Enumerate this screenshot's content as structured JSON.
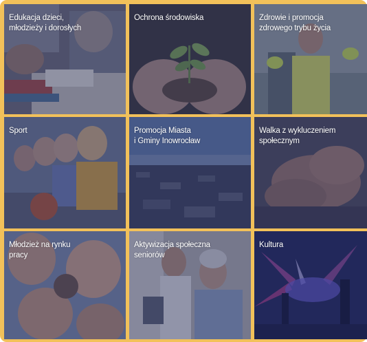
{
  "tiles": [
    {
      "label": "Edukacja dzieci,\nmłodzieży i dorosłych",
      "icon": "education-image"
    },
    {
      "label": "Ochrona środowiska",
      "icon": "environment-image"
    },
    {
      "label": "Zdrowie i promocja\nzdrowego trybu życia",
      "icon": "health-image"
    },
    {
      "label": "Sport",
      "icon": "sport-image"
    },
    {
      "label": "Promocja Miasta\ni Gminy Inowrocław",
      "icon": "city-image"
    },
    {
      "label": "Walka z wykluczeniem\nspołecznym",
      "icon": "social-inclusion-image"
    },
    {
      "label": "Młodzież na rynku\npracy",
      "icon": "youth-work-image"
    },
    {
      "label": "Aktywizacja społeczna\nseniorów",
      "icon": "seniors-image"
    },
    {
      "label": "Kultura",
      "icon": "culture-image"
    }
  ],
  "colors": {
    "frame": "#f2c15a",
    "overlay": "#283064"
  }
}
